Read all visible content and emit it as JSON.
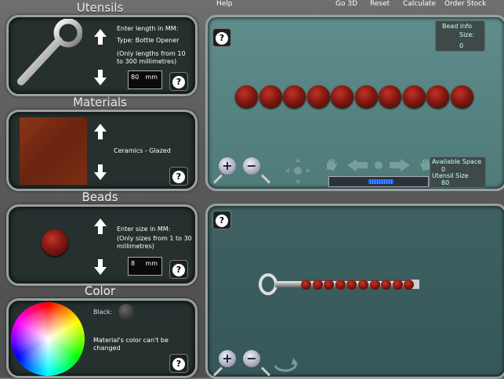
{
  "menu": {
    "help": "Help",
    "go3d": "Go 3D",
    "reset": "Reset",
    "calculate": "Calculate",
    "order_stock": "Order Stock"
  },
  "sections": {
    "utensils": "Utensils",
    "materials": "Materials",
    "beads": "Beads",
    "color": "Color"
  },
  "utensil": {
    "enter_length": "Enter length in MM:",
    "type_label": "Type: Bottle Opener",
    "range_note": "(Only lengths from 10 to 300 millimetres)",
    "length_value": "80",
    "unit": "mm"
  },
  "material": {
    "name": "Ceramics - Glazed",
    "swatch_color": "#7a2c12"
  },
  "bead": {
    "enter_size": "Enter size in MM:",
    "range_note": "(Only sizes from 1 to 30 millimetres)",
    "size_value": "8",
    "unit": "mm",
    "color": "#8a1a12"
  },
  "color_panel": {
    "black_label": "Black:",
    "note": "Material's color can't be changed"
  },
  "view_top": {
    "bead_info_title": "Bead Info",
    "bead_info_size_label": "Size:",
    "bead_info_size_value": "0",
    "available_space_label": "Available Space",
    "available_space_value": "0",
    "utensil_size_label": "Utensil Size",
    "utensil_size_value": "80",
    "bead_count": 10,
    "progress": 0.25
  },
  "view_bottom": {
    "bead_count": 10
  },
  "icons": {
    "help": "?",
    "zoom_in": "+",
    "zoom_out": "−"
  },
  "colors": {
    "accent_blue": "#1b5fff",
    "top_view_bg": "#5a8987",
    "bottom_view_bg": "#3f5f60"
  }
}
